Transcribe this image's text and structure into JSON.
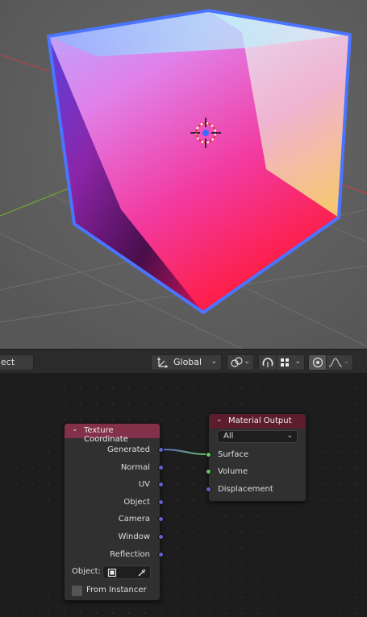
{
  "viewport": {
    "name": "3d-viewport",
    "object": "cube"
  },
  "header": {
    "mode_label": "ect",
    "orientation_label": "Global",
    "icons": [
      "transform-orientation-icon",
      "pivot-point-icon",
      "snap-icon",
      "snap-increment-icon",
      "proportional-editing-icon",
      "falloff-curve-icon"
    ]
  },
  "nodes": {
    "texture_coordinate": {
      "title": "Texture Coordinate",
      "outputs": [
        "Generated",
        "Normal",
        "UV",
        "Object",
        "Camera",
        "Window",
        "Reflection"
      ],
      "object_label": "Object:",
      "from_instancer_label": "From Instancer",
      "color": "#83314a"
    },
    "material_output": {
      "title": "Material Output",
      "target_value": "All",
      "inputs": [
        "Surface",
        "Volume",
        "Displacement"
      ],
      "color": "#5c1d2c"
    }
  },
  "colors": {
    "vector_socket": "#6363c7",
    "shader_socket": "#63c763",
    "selection_outline": "#4b74ff"
  }
}
